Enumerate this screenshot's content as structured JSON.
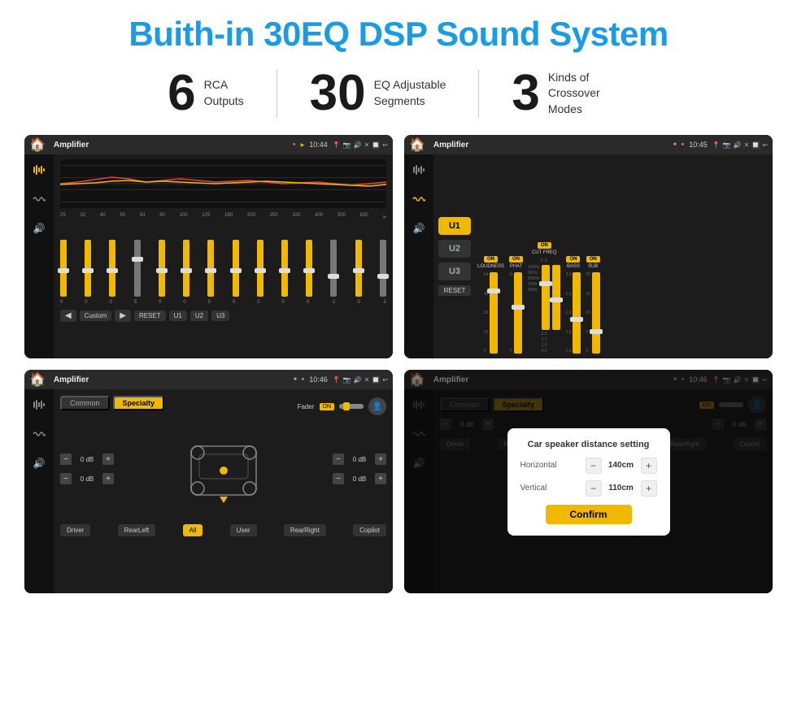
{
  "header": {
    "title": "Buith-in 30EQ DSP Sound System"
  },
  "stats": [
    {
      "number": "6",
      "label": "RCA\nOutputs"
    },
    {
      "number": "30",
      "label": "EQ Adjustable\nSegments"
    },
    {
      "number": "3",
      "label": "Kinds of\nCrossover Modes"
    }
  ],
  "screens": [
    {
      "id": "eq-screen",
      "topbar": {
        "title": "Amplifier",
        "time": "10:44",
        "icons": [
          "📍",
          "🔊",
          "✕",
          "🔲",
          "↩"
        ]
      },
      "type": "eq"
    },
    {
      "id": "mixer-screen",
      "topbar": {
        "title": "Amplifier",
        "time": "10:45",
        "icons": [
          "📍",
          "🔊",
          "✕",
          "🔲",
          "↩"
        ]
      },
      "type": "mixer",
      "bands": [
        "U1",
        "U2",
        "U3"
      ],
      "controls": [
        "LOUDNESS",
        "PHAT",
        "CUT FREQ",
        "BASS",
        "SUB"
      ],
      "reset": "RESET"
    },
    {
      "id": "crossover-screen",
      "topbar": {
        "title": "Amplifier",
        "time": "10:46",
        "icons": [
          "📍",
          "🔊",
          "✕",
          "🔲",
          "↩"
        ]
      },
      "type": "crossover",
      "tabs": [
        "Common",
        "Specialty"
      ],
      "fader_label": "Fader",
      "fader_on": "ON",
      "volumes": [
        {
          "label": "0 dB"
        },
        {
          "label": "0 dB"
        },
        {
          "label": "0 dB"
        },
        {
          "label": "0 dB"
        }
      ],
      "bottom_labels": [
        "Driver",
        "RearLeft",
        "All",
        "User",
        "RearRight",
        "Copilot"
      ]
    },
    {
      "id": "dialog-screen",
      "topbar": {
        "title": "Amplifier",
        "time": "10:46",
        "icons": [
          "📍",
          "🔊",
          "✕",
          "🔲",
          "↩"
        ]
      },
      "type": "crossover-dialog",
      "tabs": [
        "Common",
        "Specialty"
      ],
      "dialog": {
        "title": "Car speaker distance setting",
        "horizontal_label": "Horizontal",
        "horizontal_value": "140cm",
        "vertical_label": "Vertical",
        "vertical_value": "110cm",
        "confirm_label": "Confirm"
      },
      "volumes": [
        {
          "label": "0 dB"
        },
        {
          "label": "0 dB"
        }
      ]
    }
  ],
  "eq_freqs": [
    "25",
    "32",
    "40",
    "50",
    "63",
    "80",
    "100",
    "125",
    "160",
    "200",
    "250",
    "320",
    "400",
    "500",
    "630"
  ],
  "eq_values": [
    "0",
    "0",
    "0",
    "5",
    "0",
    "0",
    "0",
    "0",
    "0",
    "0",
    "0",
    "-1",
    "0",
    "-1"
  ],
  "mixer_cols": [
    {
      "label": "LOUDNESS",
      "on": true,
      "vals": [
        "64",
        "48",
        "32",
        "16",
        "0"
      ]
    },
    {
      "label": "PHAT",
      "on": true,
      "vals": [
        "G",
        "F",
        "",
        "",
        ""
      ]
    },
    {
      "label": "CUT FREQ",
      "on": true,
      "vals": [
        "3.0",
        "2.1",
        "1.3",
        "0.5"
      ]
    },
    {
      "label": "BASS",
      "on": true,
      "vals": [
        "3.0",
        "2.5",
        "2.0",
        "1.5",
        "1.0"
      ]
    },
    {
      "label": "SUB",
      "on": true,
      "vals": [
        "20",
        "15",
        "10",
        "5",
        "0"
      ]
    }
  ]
}
